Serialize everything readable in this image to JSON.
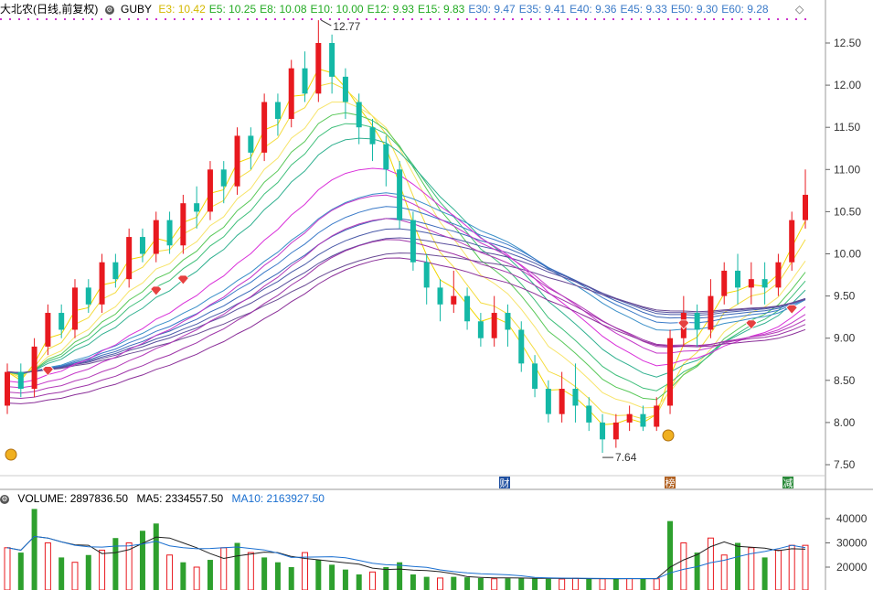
{
  "header": {
    "stock_name": "大北农",
    "mode": "(日线,前复权)",
    "indicator": "GUBY",
    "ma_items": [
      {
        "label": "E3: 10.42",
        "color": "#d4b800"
      },
      {
        "label": "E5: 10.25",
        "color": "#22aa22"
      },
      {
        "label": "E8: 10.08",
        "color": "#22aa22"
      },
      {
        "label": "E10: 10.00",
        "color": "#22aa22"
      },
      {
        "label": "E12: 9.93",
        "color": "#22aa22"
      },
      {
        "label": "E15: 9.83",
        "color": "#22aa22"
      },
      {
        "label": "E30: 9.47",
        "color": "#3a7ac8"
      },
      {
        "label": "E35: 9.41",
        "color": "#3a7ac8"
      },
      {
        "label": "E40: 9.36",
        "color": "#3a7ac8"
      },
      {
        "label": "E45: 9.33",
        "color": "#3a7ac8"
      },
      {
        "label": "E50: 9.30",
        "color": "#3a7ac8"
      },
      {
        "label": "E60: 9.28",
        "color": "#3a7ac8"
      }
    ]
  },
  "volume_header": {
    "volume": "VOLUME: 2897836.50",
    "ma5": "MA5: 2334557.50",
    "ma10": "MA10: 2163927.50",
    "ma10_color": "#1a6fd0"
  },
  "markers": {
    "high_label": "12.77",
    "low_label": "7.64",
    "tag_cai": "财",
    "tag_bang": "榜",
    "tag_jian": "减"
  },
  "chart_data": [
    {
      "type": "candlestick",
      "title": "",
      "ylim": [
        7.3,
        12.7
      ],
      "y_ticks": [
        "12.50",
        "12.00",
        "11.50",
        "11.00",
        "10.50",
        "10.00",
        "9.50",
        "9.00",
        "8.50",
        "8.00",
        "7.50"
      ],
      "y_tick_values": [
        12.5,
        12.0,
        11.5,
        11.0,
        10.5,
        10.0,
        9.5,
        9.0,
        8.5,
        8.0,
        7.5
      ],
      "high": 12.77,
      "low": 7.64,
      "candles": [
        [
          8.2,
          8.6,
          8.1,
          8.7
        ],
        [
          8.6,
          8.4,
          8.3,
          8.7
        ],
        [
          8.4,
          8.9,
          8.3,
          9.0
        ],
        [
          8.9,
          9.3,
          8.8,
          9.4
        ],
        [
          9.3,
          9.1,
          9.0,
          9.4
        ],
        [
          9.1,
          9.6,
          9.0,
          9.7
        ],
        [
          9.6,
          9.4,
          9.3,
          9.7
        ],
        [
          9.4,
          9.9,
          9.3,
          10.0
        ],
        [
          9.9,
          9.7,
          9.6,
          10.0
        ],
        [
          9.7,
          10.2,
          9.6,
          10.3
        ],
        [
          10.2,
          10.0,
          9.9,
          10.3
        ],
        [
          10.0,
          10.4,
          9.9,
          10.5
        ],
        [
          10.4,
          10.1,
          10.0,
          10.5
        ],
        [
          10.1,
          10.6,
          10.0,
          10.7
        ],
        [
          10.6,
          10.5,
          10.3,
          10.8
        ],
        [
          10.5,
          11.0,
          10.4,
          11.1
        ],
        [
          11.0,
          10.8,
          10.6,
          11.1
        ],
        [
          10.8,
          11.4,
          10.7,
          11.5
        ],
        [
          11.4,
          11.2,
          11.0,
          11.5
        ],
        [
          11.2,
          11.8,
          11.1,
          11.9
        ],
        [
          11.8,
          11.6,
          11.4,
          11.9
        ],
        [
          11.6,
          12.2,
          11.5,
          12.3
        ],
        [
          12.2,
          11.9,
          11.8,
          12.4
        ],
        [
          11.9,
          12.5,
          11.8,
          12.77
        ],
        [
          12.5,
          12.1,
          11.9,
          12.6
        ],
        [
          12.1,
          11.8,
          11.6,
          12.2
        ],
        [
          11.8,
          11.5,
          11.3,
          11.9
        ],
        [
          11.5,
          11.3,
          11.1,
          11.6
        ],
        [
          11.3,
          11.0,
          10.8,
          11.4
        ],
        [
          11.0,
          10.4,
          10.3,
          11.1
        ],
        [
          10.4,
          9.9,
          9.8,
          10.5
        ],
        [
          9.9,
          9.6,
          9.4,
          10.0
        ],
        [
          9.6,
          9.4,
          9.2,
          9.7
        ],
        [
          9.4,
          9.5,
          9.3,
          9.8
        ],
        [
          9.5,
          9.2,
          9.1,
          9.6
        ],
        [
          9.2,
          9.0,
          8.9,
          9.3
        ],
        [
          9.0,
          9.3,
          8.9,
          9.5
        ],
        [
          9.3,
          9.1,
          8.9,
          9.4
        ],
        [
          9.1,
          8.7,
          8.6,
          9.2
        ],
        [
          8.7,
          8.4,
          8.3,
          8.8
        ],
        [
          8.4,
          8.1,
          8.0,
          8.5
        ],
        [
          8.1,
          8.4,
          8.0,
          8.6
        ],
        [
          8.4,
          8.2,
          8.0,
          8.7
        ],
        [
          8.2,
          8.0,
          7.9,
          8.3
        ],
        [
          8.0,
          7.8,
          7.64,
          8.1
        ],
        [
          7.8,
          8.0,
          7.7,
          8.1
        ],
        [
          8.0,
          8.1,
          7.9,
          8.2
        ],
        [
          8.1,
          7.95,
          7.9,
          8.2
        ],
        [
          7.95,
          8.2,
          7.9,
          8.3
        ],
        [
          8.2,
          9.0,
          8.1,
          9.1
        ],
        [
          9.0,
          9.3,
          8.9,
          9.5
        ],
        [
          9.3,
          9.1,
          8.9,
          9.4
        ],
        [
          9.1,
          9.5,
          9.0,
          9.7
        ],
        [
          9.5,
          9.8,
          9.4,
          9.9
        ],
        [
          9.8,
          9.6,
          9.4,
          10.0
        ],
        [
          9.6,
          9.7,
          9.4,
          9.9
        ],
        [
          9.7,
          9.6,
          9.4,
          9.9
        ],
        [
          9.6,
          9.9,
          9.5,
          10.0
        ],
        [
          9.9,
          10.4,
          9.8,
          10.5
        ],
        [
          10.4,
          10.7,
          10.3,
          11.0
        ]
      ],
      "envelope": {
        "colors": [
          "#f2d600",
          "#f4dc40",
          "#f7e46a",
          "#d92fd9",
          "#c53ac9",
          "#b33bb8",
          "#9e35a8",
          "#8a2e98"
        ],
        "note": ""
      }
    },
    {
      "type": "bar",
      "title": "",
      "y_ticks": [
        "40000",
        "30000",
        "20000"
      ],
      "y_tick_values": [
        40000,
        30000,
        20000
      ],
      "ylim": [
        15000,
        45000
      ],
      "values": [
        28000,
        26000,
        44000,
        30000,
        24000,
        22000,
        25000,
        27000,
        32000,
        30000,
        35000,
        38000,
        25000,
        22000,
        20000,
        23000,
        28000,
        30000,
        26000,
        24000,
        22000,
        20000,
        26000,
        23000,
        21000,
        19000,
        17000,
        18000,
        20000,
        22000,
        17000,
        16000,
        15500,
        16000,
        15800,
        15500,
        15200,
        15400,
        15600,
        15300,
        15200,
        15100,
        15400,
        15300,
        15200,
        15100,
        15300,
        15400,
        15200,
        39000,
        30000,
        26000,
        32000,
        25000,
        30000,
        28000,
        24000,
        27000,
        29000,
        29000
      ],
      "up": [
        true,
        false,
        false,
        true,
        false,
        true,
        false,
        true,
        false,
        true,
        false,
        false,
        true,
        false,
        true,
        false,
        true,
        false,
        true,
        false,
        false,
        false,
        true,
        false,
        false,
        false,
        false,
        true,
        false,
        false,
        false,
        false,
        true,
        false,
        false,
        false,
        true,
        false,
        false,
        false,
        false,
        true,
        true,
        false,
        true,
        false,
        true,
        false,
        true,
        false,
        true,
        false,
        true,
        true,
        false,
        true,
        false,
        true,
        true,
        true
      ]
    }
  ]
}
